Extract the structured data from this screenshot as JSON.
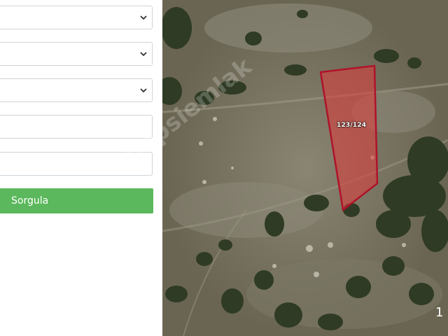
{
  "form": {
    "selects": [
      {
        "value": ""
      },
      {
        "value": ""
      },
      {
        "value": ""
      }
    ],
    "inputs": [
      {
        "value": ""
      },
      {
        "value": ""
      }
    ],
    "query_button": "Sorgula"
  },
  "map": {
    "parcel_label": "123/124",
    "watermark": "hepsiemlak",
    "scale_text": "1",
    "parcel_color": "#e03a3a"
  }
}
